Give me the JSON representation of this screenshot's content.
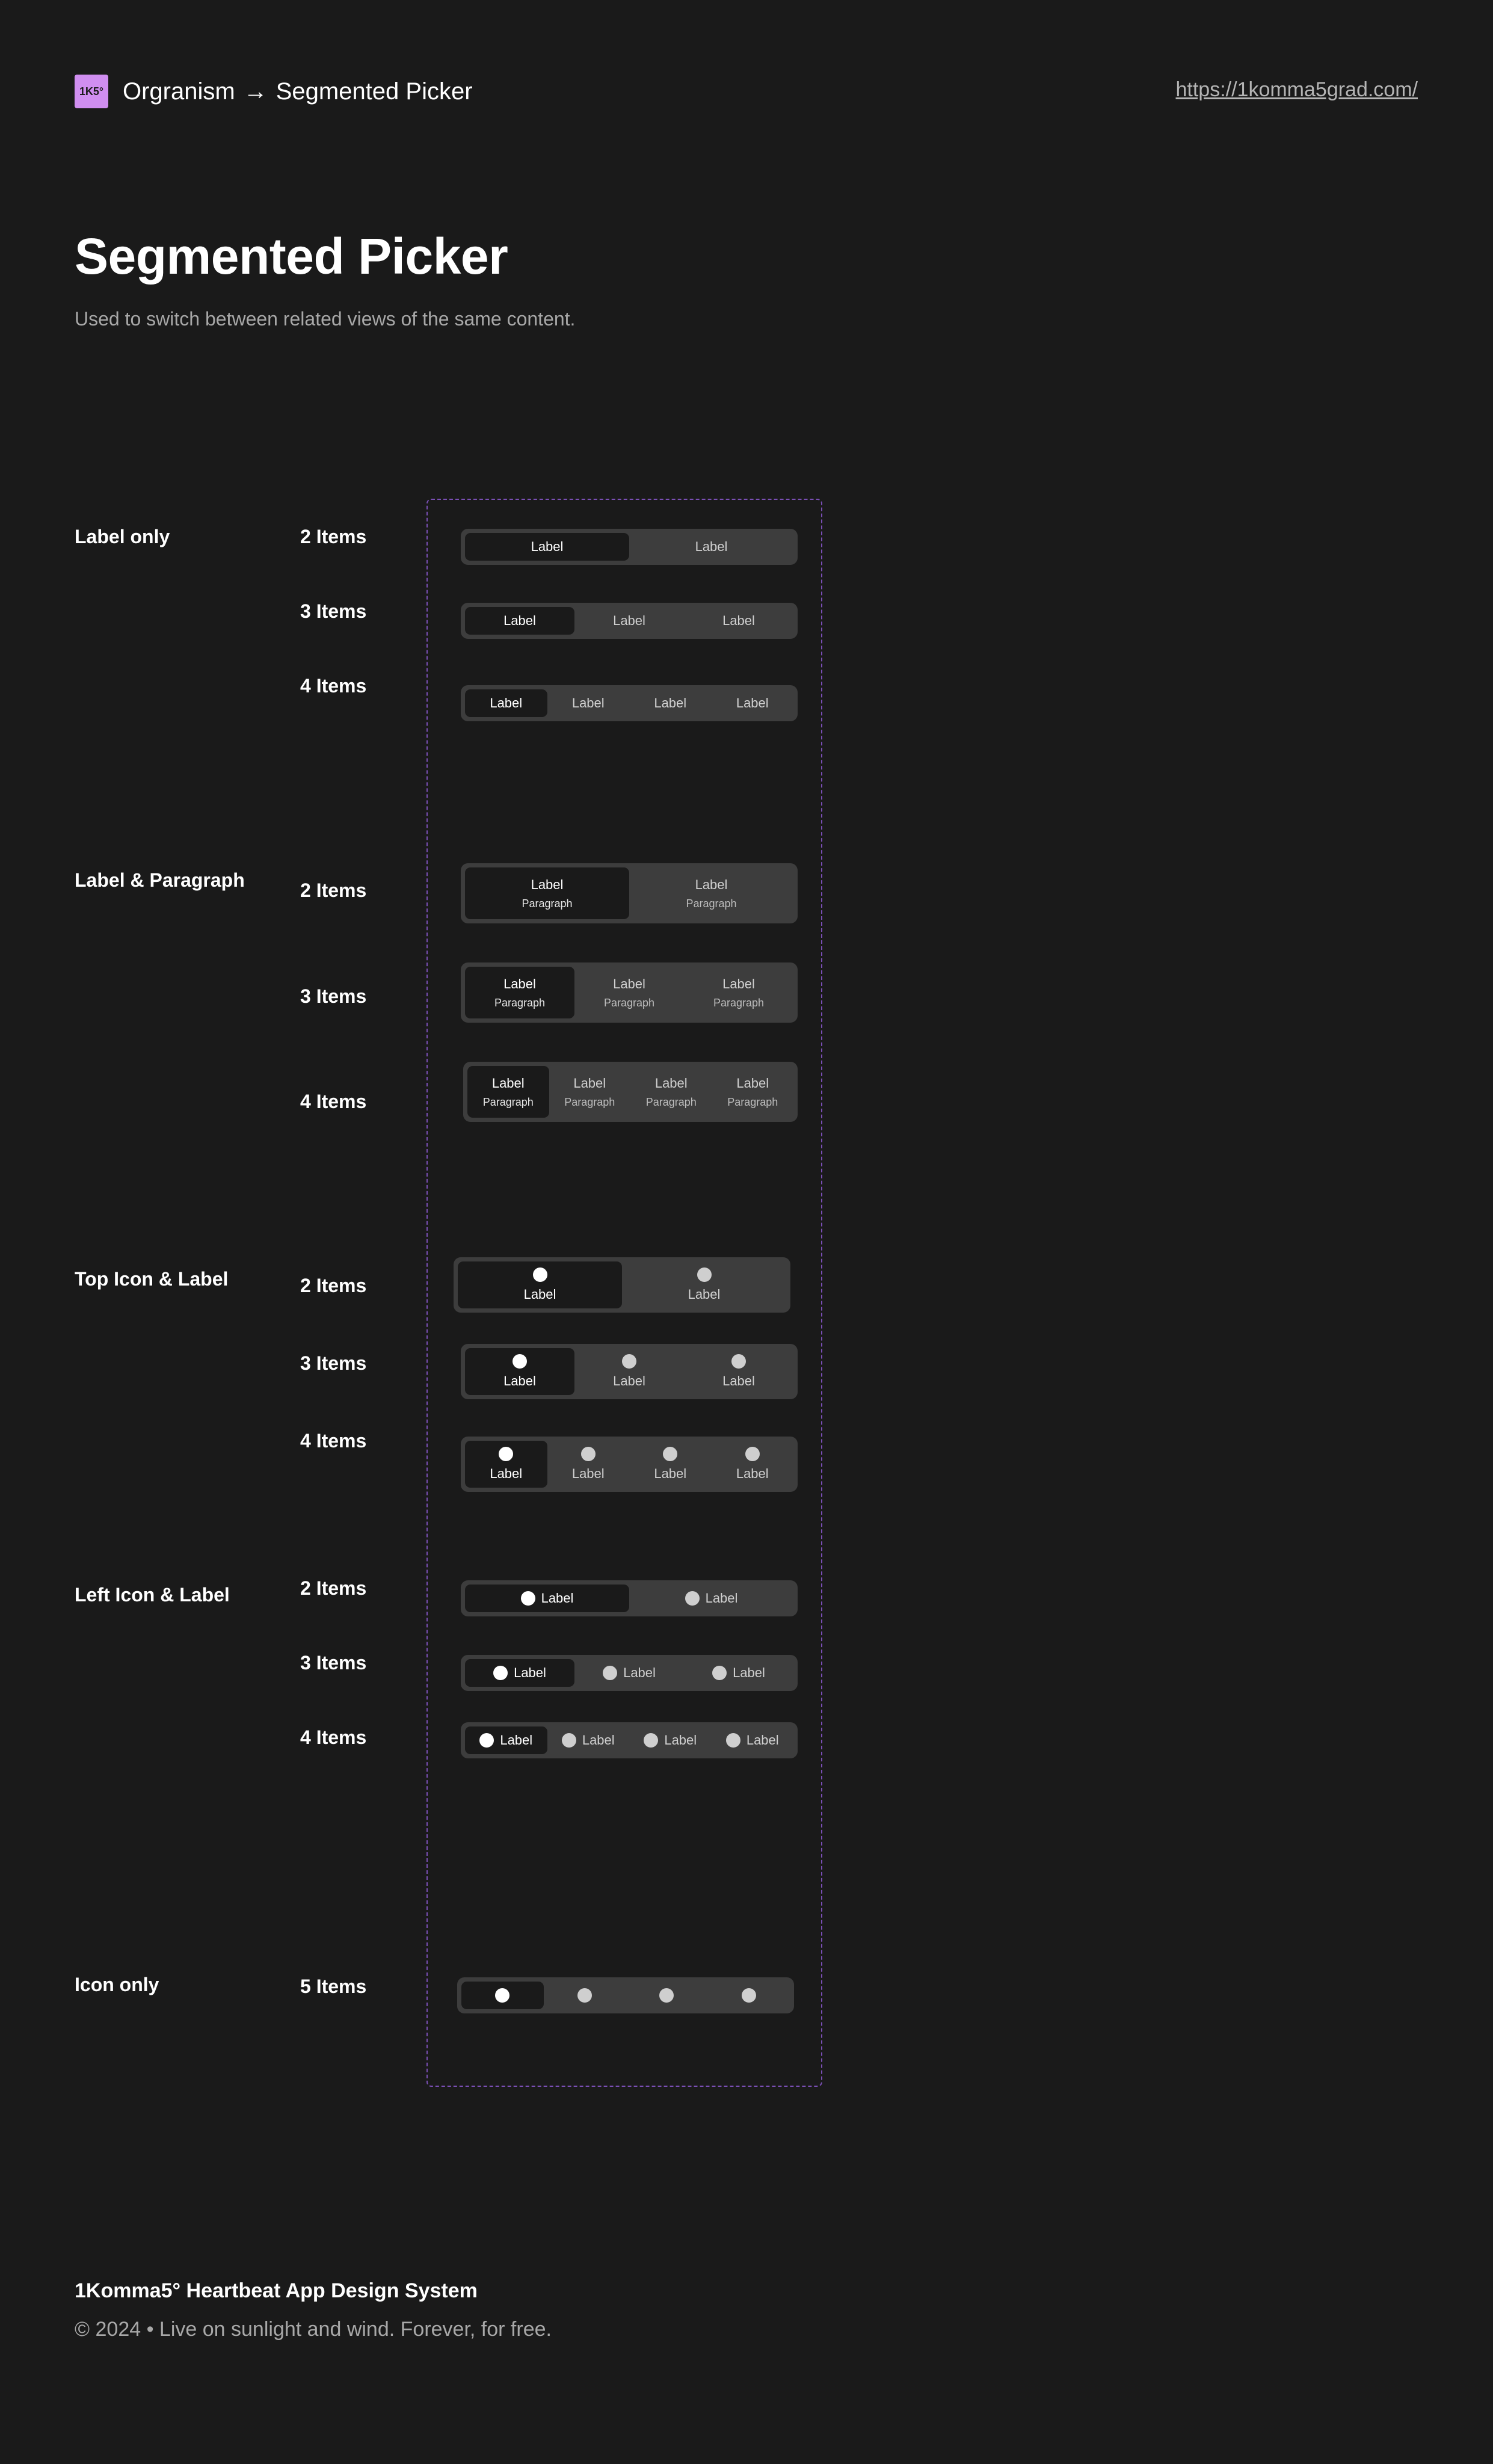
{
  "header": {
    "logo_text": "1K5°",
    "crumb_parent": "Orgranism",
    "crumb_arrow": "→",
    "crumb_current": "Segmented Picker",
    "site_link": "https://1komma5grad.com/"
  },
  "page": {
    "title": "Segmented Picker",
    "subtitle": "Used to switch between related views of the same content."
  },
  "sections": {
    "label_only": "Label only",
    "label_paragraph": "Label & Paragraph",
    "top_icon_label": "Top Icon & Label",
    "left_icon_label": "Left Icon & Label",
    "icon_only": "Icon only"
  },
  "counts": {
    "two": "2 Items",
    "three": "3 Items",
    "four": "4 Items",
    "five": "5 Items"
  },
  "segment": {
    "label": "Label",
    "paragraph": "Paragraph",
    "icon": "circle-icon"
  },
  "colors": {
    "background": "#1a1a1a",
    "picker_track": "#3d3d3d",
    "active_segment": "#1a1a1a",
    "frame_border": "#7a4fb5",
    "logo_bg": "#d08ef0"
  },
  "footer": {
    "title": "1Komma5° Heartbeat App Design System",
    "copy": "© 2024 • Live on sunlight and wind. Forever, for free."
  }
}
